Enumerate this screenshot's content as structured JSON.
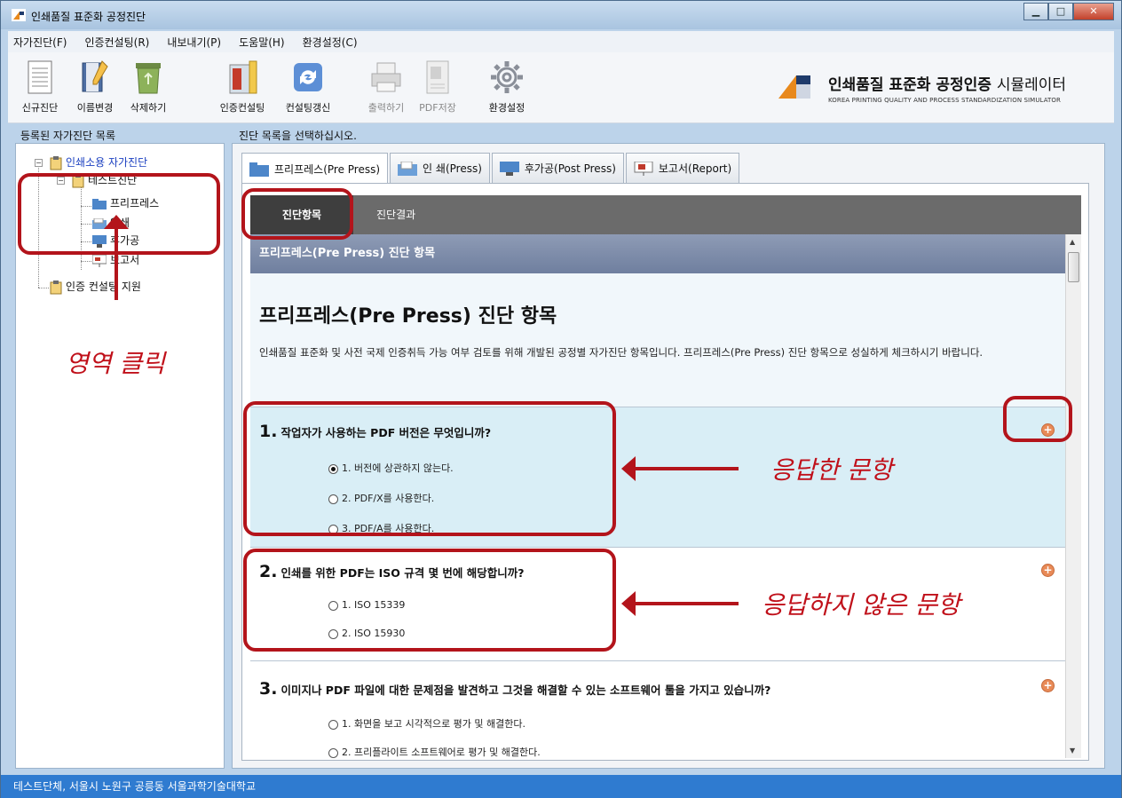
{
  "window": {
    "title": "인쇄품질 표준화 공정진단"
  },
  "menu": [
    "자가진단(F)",
    "인증컨설팅(R)",
    "내보내기(P)",
    "도움말(H)",
    "환경설정(C)"
  ],
  "toolbar": {
    "new_diag": "신규진단",
    "rename": "이름변경",
    "delete": "삭제하기",
    "cert_consult": "인증컨설팅",
    "consult_update": "컨설팅갱신",
    "print": "출력하기",
    "pdf_save": "PDF저장",
    "settings": "환경설정"
  },
  "brand": {
    "title_bold": "인쇄품질 표준화 공정인증",
    "title_normal": "시뮬레이터",
    "subtitle": "KOREA PRINTING QUALITY AND PROCESS STANDARDIZATION SIMULATOR"
  },
  "left_panel": {
    "label": "등록된 자가진단 목록",
    "tree": {
      "root": "인쇄소용 자가진단",
      "test": "테스트진단",
      "prepress": "프리프레스",
      "press": "인쇄",
      "postpress": "후가공",
      "report": "보고서",
      "cert_support": "인증 컨설팅 지원"
    }
  },
  "right_panel": {
    "label": "진단 목록을 선택하십시오.",
    "tabs": [
      "프리프레스(Pre Press)",
      "인 쇄(Press)",
      "후가공(Post Press)",
      "보고서(Report)"
    ],
    "subtabs": {
      "items": "진단항목",
      "results": "진단결과"
    },
    "section_header": "프리프레스(Pre Press) 진단 항목",
    "intro_title": "프리프레스(Pre Press) 진단 항목",
    "intro_desc": "인쇄품질 표준화 및 사전 국제 인증취득 가능 여부 검토를 위해 개발된 공정별 자가진단 항목입니다. 프리프레스(Pre Press) 진단 항목으로 성실하게 체크하시기 바랍니다.",
    "questions": [
      {
        "num": "1.",
        "text": "작업자가 사용하는 PDF 버전은 무엇입니까?",
        "options": [
          "1. 버전에 상관하지 않는다.",
          "2. PDF/X를 사용한다.",
          "3. PDF/A를 사용한다."
        ]
      },
      {
        "num": "2.",
        "text": "인쇄를 위한 PDF는 ISO 규격 몇 번에 해당합니까?",
        "options": [
          "1. ISO 15339",
          "2. ISO 15930"
        ]
      },
      {
        "num": "3.",
        "text": "이미지나 PDF 파일에 대한 문제점을 발견하고 그것을 해결할 수 있는 소프트웨어 툴을 가지고 있습니까?",
        "options": [
          "1. 화면을 보고 시각적으로 평가 및 해결한다.",
          "2. 프리플라이트 소프트웨어로 평가 및 해결한다."
        ]
      }
    ]
  },
  "status": "테스트단체, 서울시 노원구 공릉동 서울과학기술대학교",
  "annotations": {
    "area_click": "영역 클릭",
    "answered": "응답한 문항",
    "unanswered": "응답하지 않은 문항"
  },
  "colors": {
    "annotation": "#b3141b",
    "statusbar": "#2f7bd0",
    "accent_plus": "#e88a57"
  }
}
